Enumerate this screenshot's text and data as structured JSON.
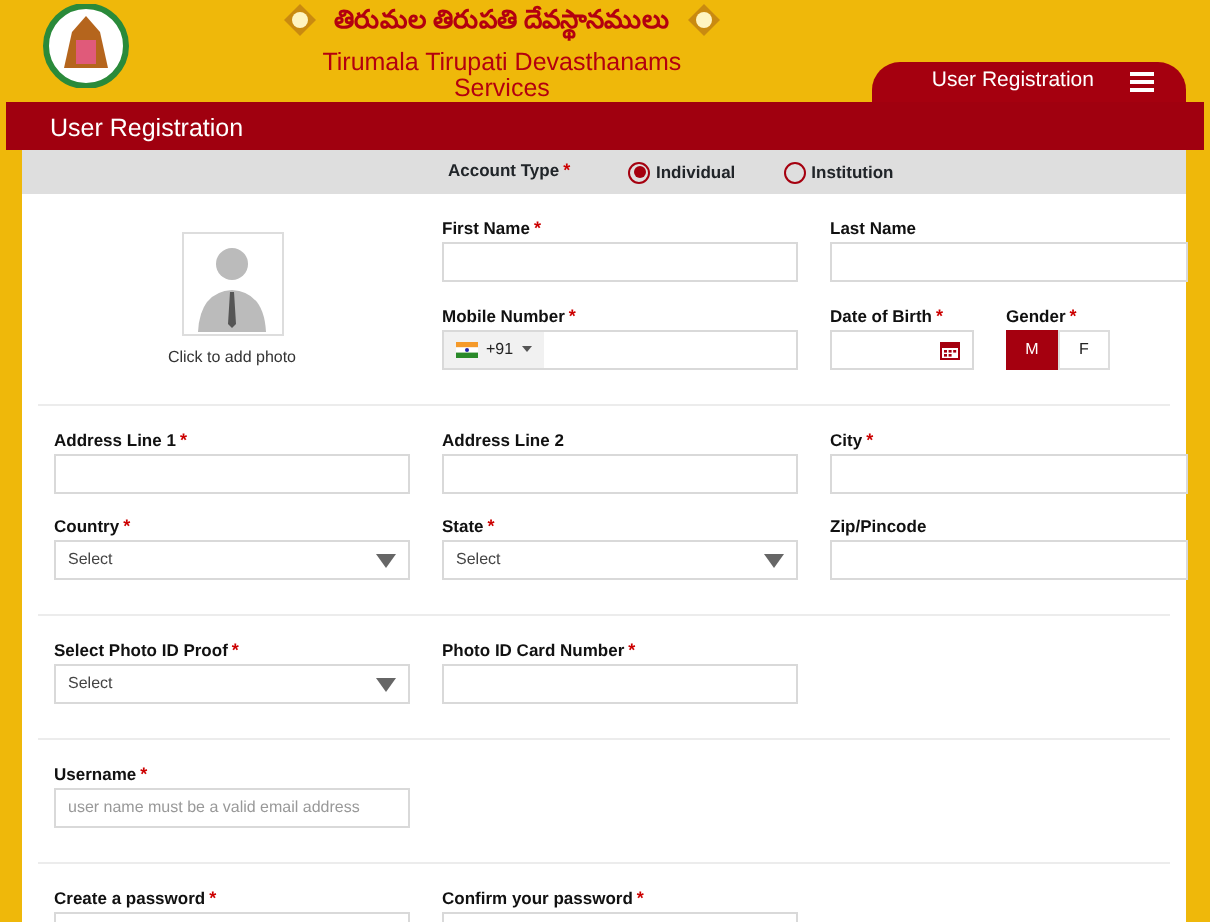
{
  "header": {
    "telugu_title": "తిరుమల తిరుపతి దేవస్థానములు",
    "title": "Tirumala Tirupati Devasthanams",
    "subtitle": "Services",
    "nav_label": "User Registration"
  },
  "page_title": "User Registration",
  "account_type": {
    "label": "Account Type",
    "marker": "*",
    "options": [
      {
        "label": "Individual",
        "selected": true
      },
      {
        "label": "Institution",
        "selected": false
      }
    ]
  },
  "photo": {
    "caption": "Click to add photo"
  },
  "sections": [
    {
      "fields": [
        {
          "kind": "text",
          "label": "First Name",
          "marker": "*"
        },
        {
          "kind": "text",
          "label": "Last Name"
        },
        {
          "kind": "phone",
          "label": "Mobile Number",
          "marker": "*",
          "country_code": "+91"
        },
        {
          "kind": "date",
          "label": "Date of Birth",
          "marker": "*"
        },
        {
          "kind": "gender",
          "label": "Gender",
          "marker": "*",
          "options": [
            {
              "label": "M",
              "selected": true
            },
            {
              "label": "F",
              "selected": false
            }
          ]
        }
      ]
    },
    {
      "fields": [
        {
          "kind": "text",
          "label": "Address Line 1",
          "marker": "*"
        },
        {
          "kind": "text",
          "label": "Address Line 2"
        },
        {
          "kind": "text",
          "label": "City",
          "marker": "*"
        },
        {
          "kind": "select",
          "label": "Country",
          "marker": "*",
          "value": "Select"
        },
        {
          "kind": "select",
          "label": "State",
          "marker": "*",
          "value": "Select"
        },
        {
          "kind": "text",
          "label": "Zip/Pincode"
        }
      ]
    },
    {
      "fields": [
        {
          "kind": "select",
          "label": "Select Photo ID Proof",
          "marker": "*",
          "value": "Select"
        },
        {
          "kind": "text",
          "label": "Photo ID Card Number",
          "marker": "*"
        }
      ]
    },
    {
      "fields": [
        {
          "kind": "text",
          "label": "Username",
          "marker": "*",
          "placeholder": "user name must be a valid email address"
        }
      ]
    },
    {
      "fields": [
        {
          "kind": "text",
          "label": "Create a password",
          "marker": "*"
        },
        {
          "kind": "text",
          "label": "Confirm your password",
          "marker": "*"
        }
      ]
    }
  ]
}
